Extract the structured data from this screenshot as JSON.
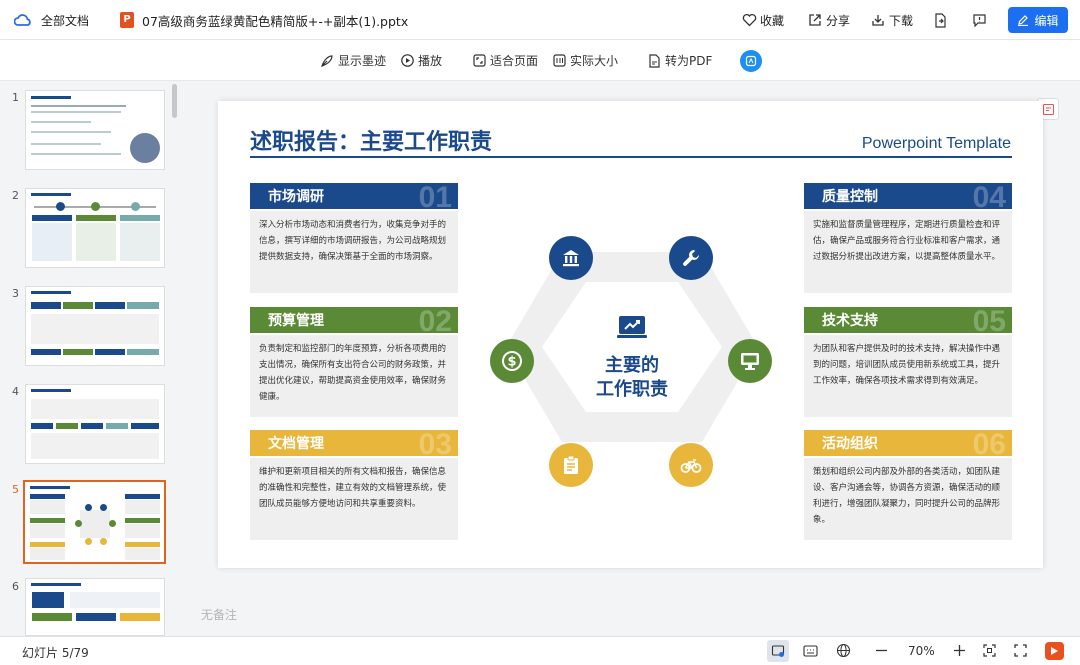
{
  "topbar": {
    "home": "全部文档",
    "filename": "07高级商务蓝绿黄配色精简版+-+副本(1).pptx",
    "favorite": "收藏",
    "share": "分享",
    "download": "下载",
    "edit": "编辑"
  },
  "toolbar": {
    "ink": "显示墨迹",
    "play": "播放",
    "fit": "适合页面",
    "actual": "实际大小",
    "pdf": "转为PDF"
  },
  "thumbs": [
    {
      "n": "1"
    },
    {
      "n": "2"
    },
    {
      "n": "3"
    },
    {
      "n": "4"
    },
    {
      "n": "5"
    },
    {
      "n": "6"
    }
  ],
  "slide": {
    "title": "述职报告：主要工作职责",
    "template": "Powerpoint Template",
    "center_line1": "主要的",
    "center_line2": "工作职责",
    "cards": [
      {
        "title": "市场调研",
        "num": "01",
        "text": "深入分析市场动态和消费者行为，收集竞争对手的信息，撰写详细的市场调研报告，为公司战略规划提供数据支持，确保决策基于全面的市场洞察。"
      },
      {
        "title": "预算管理",
        "num": "02",
        "text": "负责制定和监控部门的年度预算，分析各项费用的支出情况，确保所有支出符合公司的财务政策，并提出优化建议，帮助提高资金使用效率，确保财务健康。"
      },
      {
        "title": "文档管理",
        "num": "03",
        "text": "维护和更新项目相关的所有文档和报告，确保信息的准确性和完整性，建立有效的文档管理系统，使团队成员能够方便地访问和共享重要资料。"
      },
      {
        "title": "质量控制",
        "num": "04",
        "text": "实施和监督质量管理程序，定期进行质量检查和评估，确保产品或服务符合行业标准和客户需求，通过数据分析提出改进方案，以提高整体质量水平。"
      },
      {
        "title": "技术支持",
        "num": "05",
        "text": "为团队和客户提供及时的技术支持，解决操作中遇到的问题，培训团队成员使用新系统或工具，提升工作效率，确保各项技术需求得到有效满足。"
      },
      {
        "title": "活动组织",
        "num": "06",
        "text": "策划和组织公司内部及外部的各类活动，如团队建设、客户沟通会等，协调各方资源，确保活动的顺利进行，增强团队凝聚力，同时提升公司的品牌形象。"
      }
    ]
  },
  "notes": "无备注",
  "bottombar": {
    "slide_count": "幻灯片 5/79",
    "zoom": "70%"
  },
  "colors": {
    "blue": "#1b4a8c",
    "green": "#5a8a35",
    "yellow": "#e8b63a",
    "accent": "#1d6ff2"
  }
}
